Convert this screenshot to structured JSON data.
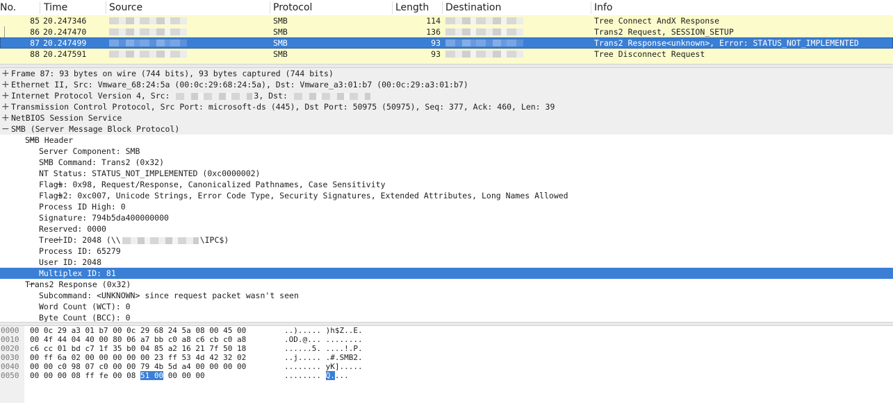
{
  "packet_list": {
    "columns": [
      "No.",
      "Time",
      "Source",
      "Protocol",
      "Length",
      "Destination",
      "Info"
    ],
    "rows": [
      {
        "no": "85",
        "time": "20.247346",
        "source": "",
        "protocol": "SMB",
        "length": "114",
        "destination": "",
        "info": "Tree Connect AndX Response"
      },
      {
        "no": "86",
        "time": "20.247470",
        "source": "",
        "protocol": "SMB",
        "length": "136",
        "destination": "",
        "info": "Trans2 Request, SESSION_SETUP"
      },
      {
        "no": "87",
        "time": "20.247499",
        "source": "",
        "protocol": "SMB",
        "length": "93",
        "destination": "",
        "info": "Trans2 Response<unknown>, Error: STATUS_NOT_IMPLEMENTED",
        "selected": true
      },
      {
        "no": "88",
        "time": "20.247591",
        "source": "",
        "protocol": "SMB",
        "length": "93",
        "destination": "",
        "info": "Tree Disconnect Request"
      }
    ]
  },
  "details": {
    "lines": [
      {
        "text": "Frame 87: 93 bytes on wire (744 bits), 93 bytes captured (744 bits)",
        "indent": 0,
        "expander": "+",
        "top": true
      },
      {
        "text": "Ethernet II, Src: Vmware_68:24:5a (00:0c:29:68:24:5a), Dst: Vmware_a3:01:b7 (00:0c:29:a3:01:b7)",
        "indent": 0,
        "expander": "+",
        "top": true
      },
      {
        "text_before": "Internet Protocol Version 4, Src: ",
        "text_mid": "3, Dst: ",
        "text_after": "",
        "indent": 0,
        "expander": "+",
        "top": true,
        "redacted": true
      },
      {
        "text": "Transmission Control Protocol, Src Port: microsoft-ds (445), Dst Port: 50975 (50975), Seq: 377, Ack: 460, Len: 39",
        "indent": 0,
        "expander": "+",
        "top": true
      },
      {
        "text": "NetBIOS Session Service",
        "indent": 0,
        "expander": "+",
        "top": true
      },
      {
        "text": "SMB (Server Message Block Protocol)",
        "indent": 0,
        "expander": "−",
        "top": true
      },
      {
        "text": "SMB Header",
        "indent": 1,
        "expander": "−"
      },
      {
        "text": "Server Component: SMB",
        "indent": 2,
        "expander": ""
      },
      {
        "text": "SMB Command: Trans2 (0x32)",
        "indent": 2,
        "expander": ""
      },
      {
        "text": "NT Status: STATUS_NOT_IMPLEMENTED (0xc0000002)",
        "indent": 2,
        "expander": ""
      },
      {
        "text": "Flags: 0x98, Request/Response, Canonicalized Pathnames, Case Sensitivity",
        "indent": 2,
        "expander": "+"
      },
      {
        "text": "Flags2: 0xc007, Unicode Strings, Error Code Type, Security Signatures, Extended Attributes, Long Names Allowed",
        "indent": 2,
        "expander": "+"
      },
      {
        "text": "Process ID High: 0",
        "indent": 2,
        "expander": ""
      },
      {
        "text": "Signature: 794b5da400000000",
        "indent": 2,
        "expander": ""
      },
      {
        "text": "Reserved: 0000",
        "indent": 2,
        "expander": ""
      },
      {
        "text_before": "Tree ID: 2048  (\\\\",
        "text_mid": "\\IPC$)",
        "text_after": "",
        "indent": 2,
        "expander": "+",
        "redacted_tree": true
      },
      {
        "text": "Process ID: 65279",
        "indent": 2,
        "expander": ""
      },
      {
        "text": "User ID: 2048",
        "indent": 2,
        "expander": ""
      },
      {
        "text": "Multiplex ID: 81",
        "indent": 2,
        "expander": "",
        "selected": true
      },
      {
        "text": "Trans2 Response (0x32)",
        "indent": 1,
        "expander": "−"
      },
      {
        "text": "Subcommand: <UNKNOWN> since request packet wasn't seen",
        "indent": 2,
        "expander": ""
      },
      {
        "text": "Word Count (WCT): 0",
        "indent": 2,
        "expander": ""
      },
      {
        "text": "Byte Count (BCC): 0",
        "indent": 2,
        "expander": ""
      }
    ]
  },
  "bytes": {
    "rows": [
      {
        "offset": "0000",
        "hex_a": "00 0c 29 a3 01 b7 00 0c",
        "hex_b": "29 68 24 5a 08 00 45 00",
        "ascii_a": "..).....",
        "ascii_b": ")h$Z..E."
      },
      {
        "offset": "0010",
        "hex_a": "00 4f 44 04 40 00 80 06",
        "hex_b": "a7 bb c0 a8 c6 cb c0 a8",
        "ascii_a": ".OD.@...",
        "ascii_b": "........"
      },
      {
        "offset": "0020",
        "hex_a": "c6 cc 01 bd c7 1f 35 b0",
        "hex_b": "04 85 a2 16 21 7f 50 18",
        "ascii_a": "......5.",
        "ascii_b": "....!.P."
      },
      {
        "offset": "0030",
        "hex_a": "00 ff 6a 02 00 00 00 00",
        "hex_b": "00 23 ff 53 4d 42 32 02",
        "ascii_a": "..j.....",
        "ascii_b": ".#.SMB2."
      },
      {
        "offset": "0040",
        "hex_a": "00 00 c0 98 07 c0 00 00",
        "hex_b": "79 4b 5d a4 00 00 00 00",
        "ascii_a": "........",
        "ascii_b": "yK]....."
      },
      {
        "offset": "0050",
        "hex_a": "00 00 00 08 ff fe 00 08",
        "hex_b_hl": "51 00",
        "hex_b_rest": " 00 00 00",
        "ascii_a": "........",
        "ascii_b_hl": "Q.",
        "ascii_b_rest": "..."
      }
    ]
  }
}
